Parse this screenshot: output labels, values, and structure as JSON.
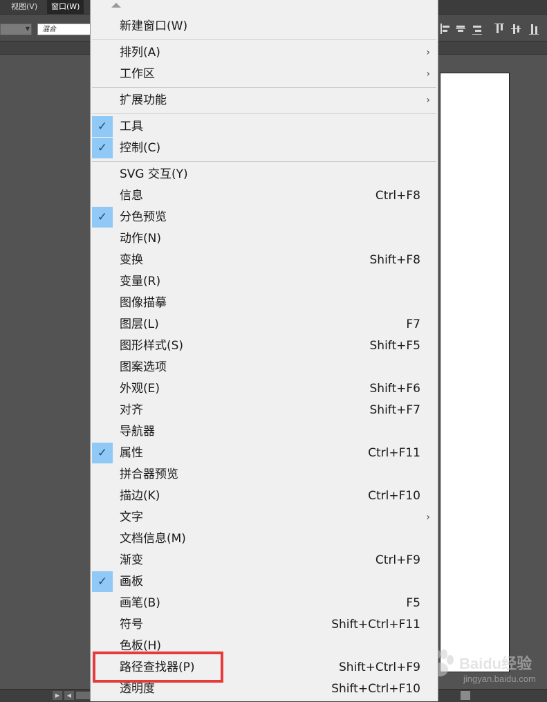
{
  "menubar": {
    "view": "视图(V)",
    "window": "窗口(W)"
  },
  "control_bar": {
    "blend_mode": "混合"
  },
  "menu": {
    "items": [
      {
        "label": "新建窗口(W)",
        "shortcut": "",
        "checked": false,
        "submenu": false
      },
      {
        "label": "排列(A)",
        "shortcut": "",
        "checked": false,
        "submenu": true
      },
      {
        "label": "工作区",
        "shortcut": "",
        "checked": false,
        "submenu": true
      },
      {
        "label": "扩展功能",
        "shortcut": "",
        "checked": false,
        "submenu": true
      },
      {
        "label": "工具",
        "shortcut": "",
        "checked": true,
        "submenu": false
      },
      {
        "label": "控制(C)",
        "shortcut": "",
        "checked": true,
        "submenu": false
      },
      {
        "label": "SVG 交互(Y)",
        "shortcut": "",
        "checked": false,
        "submenu": false
      },
      {
        "label": "信息",
        "shortcut": "Ctrl+F8",
        "checked": false,
        "submenu": false
      },
      {
        "label": "分色预览",
        "shortcut": "",
        "checked": true,
        "submenu": false
      },
      {
        "label": "动作(N)",
        "shortcut": "",
        "checked": false,
        "submenu": false
      },
      {
        "label": "变换",
        "shortcut": "Shift+F8",
        "checked": false,
        "submenu": false
      },
      {
        "label": "变量(R)",
        "shortcut": "",
        "checked": false,
        "submenu": false
      },
      {
        "label": "图像描摹",
        "shortcut": "",
        "checked": false,
        "submenu": false
      },
      {
        "label": "图层(L)",
        "shortcut": "F7",
        "checked": false,
        "submenu": false
      },
      {
        "label": "图形样式(S)",
        "shortcut": "Shift+F5",
        "checked": false,
        "submenu": false
      },
      {
        "label": "图案选项",
        "shortcut": "",
        "checked": false,
        "submenu": false
      },
      {
        "label": "外观(E)",
        "shortcut": "Shift+F6",
        "checked": false,
        "submenu": false
      },
      {
        "label": "对齐",
        "shortcut": "Shift+F7",
        "checked": false,
        "submenu": false
      },
      {
        "label": "导航器",
        "shortcut": "",
        "checked": false,
        "submenu": false
      },
      {
        "label": "属性",
        "shortcut": "Ctrl+F11",
        "checked": true,
        "submenu": false
      },
      {
        "label": "拼合器预览",
        "shortcut": "",
        "checked": false,
        "submenu": false
      },
      {
        "label": "描边(K)",
        "shortcut": "Ctrl+F10",
        "checked": false,
        "submenu": false
      },
      {
        "label": "文字",
        "shortcut": "",
        "checked": false,
        "submenu": true
      },
      {
        "label": "文档信息(M)",
        "shortcut": "",
        "checked": false,
        "submenu": false
      },
      {
        "label": "渐变",
        "shortcut": "Ctrl+F9",
        "checked": false,
        "submenu": false
      },
      {
        "label": "画板",
        "shortcut": "",
        "checked": true,
        "submenu": false
      },
      {
        "label": "画笔(B)",
        "shortcut": "F5",
        "checked": false,
        "submenu": false
      },
      {
        "label": "符号",
        "shortcut": "Shift+Ctrl+F11",
        "checked": false,
        "submenu": false
      },
      {
        "label": "色板(H)",
        "shortcut": "",
        "checked": false,
        "submenu": false
      },
      {
        "label": "路径查找器(P)",
        "shortcut": "Shift+Ctrl+F9",
        "checked": false,
        "submenu": false
      },
      {
        "label": "透明度",
        "shortcut": "Shift+Ctrl+F10",
        "checked": false,
        "submenu": false
      }
    ],
    "check_glyph": "✓",
    "submenu_glyph": "›",
    "highlight_color": "#e53b3b"
  },
  "watermark": {
    "brand": "Baidu经验",
    "url": "jingyan.baidu.com"
  }
}
